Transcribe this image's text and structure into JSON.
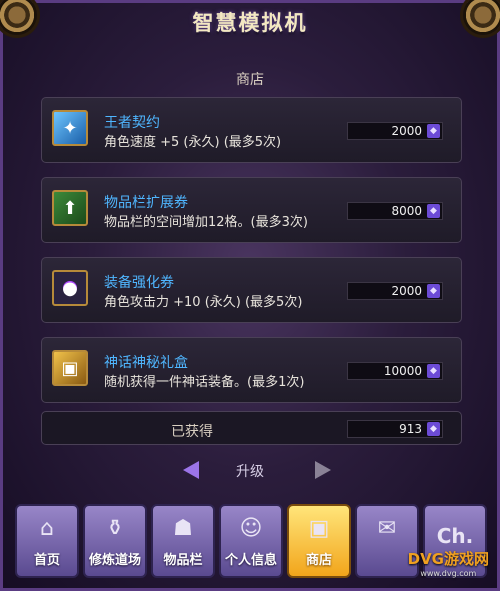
{
  "window": {
    "title": "智慧模拟机"
  },
  "shop": {
    "title": "商店",
    "items": [
      {
        "name": "王者契约",
        "desc": "角色速度 +5 (永久) (最多5次)",
        "price": "2000",
        "icon": "contract-icon"
      },
      {
        "name": "物品栏扩展券",
        "desc": "物品栏的空间增加12格。(最多3次)",
        "price": "8000",
        "icon": "inventory-expand-icon"
      },
      {
        "name": "装备强化券",
        "desc": "角色攻击力 +10 (永久) (最多5次)",
        "price": "2000",
        "icon": "enhance-ticket-icon"
      },
      {
        "name": "神话神秘礼盒",
        "desc": "随机获得一件神话装备。(最多1次)",
        "price": "10000",
        "icon": "mystery-box-icon"
      }
    ],
    "currency_icon": "purple-crystal-icon",
    "obtained_label": "已获得",
    "obtained_value": "913"
  },
  "pager": {
    "label": "升级"
  },
  "tabs": [
    {
      "label": "首页",
      "icon": "home-icon",
      "active": false
    },
    {
      "label": "修炼道场",
      "icon": "training-icon",
      "active": false
    },
    {
      "label": "物品栏",
      "icon": "inventory-icon",
      "active": false
    },
    {
      "label": "个人信息",
      "icon": "profile-icon",
      "active": false
    },
    {
      "label": "商店",
      "icon": "shop-icon",
      "active": true
    },
    {
      "label": "",
      "icon": "scroll-icon",
      "active": false
    },
    {
      "label": "Ch.",
      "icon": "channel-icon",
      "active": false
    }
  ],
  "watermark": {
    "text": "DVG游戏网",
    "sub": "www.dvg.com"
  },
  "colors": {
    "accent": "#4fb6ff",
    "active_tab": "#f2a51b",
    "tab": "#7a68b0"
  }
}
